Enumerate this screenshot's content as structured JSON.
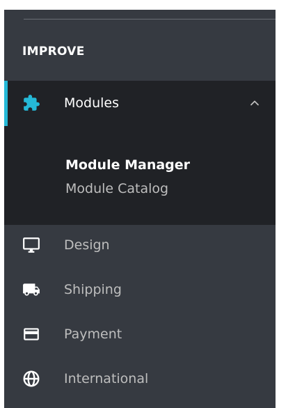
{
  "section": {
    "title": "IMPROVE"
  },
  "menu": {
    "modules": {
      "label": "Modules",
      "icon": "puzzle-icon",
      "expanded": true,
      "submenu": [
        {
          "label": "Module Manager",
          "current": true
        },
        {
          "label": "Module Catalog",
          "current": false
        }
      ]
    },
    "items": [
      {
        "label": "Design",
        "icon": "monitor-icon"
      },
      {
        "label": "Shipping",
        "icon": "truck-icon"
      },
      {
        "label": "Payment",
        "icon": "credit-card-icon"
      },
      {
        "label": "International",
        "icon": "globe-icon"
      }
    ]
  },
  "colors": {
    "sidebar_bg": "#363a41",
    "active_bg": "#202226",
    "accent": "#25b9d7",
    "text_muted": "#bebebe",
    "text_bright": "#ffffff"
  }
}
